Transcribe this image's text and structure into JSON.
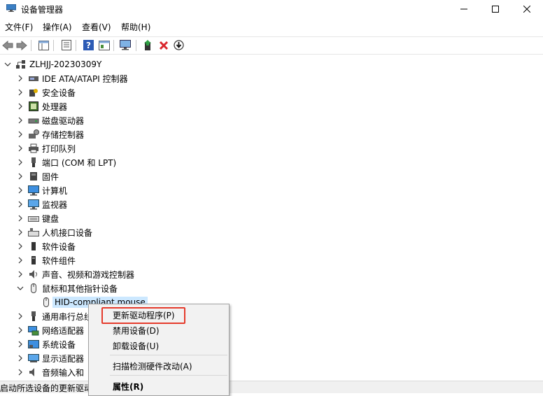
{
  "window": {
    "title": "设备管理器"
  },
  "menu": [
    "文件(F)",
    "操作(A)",
    "查看(V)",
    "帮助(H)"
  ],
  "toolbar": {
    "icons": [
      "back-arrow-icon",
      "forward-arrow-icon",
      "properties-icon",
      "driver-icon",
      "help-icon",
      "view-icon",
      "monitor-scan-icon",
      "update-driver-icon",
      "uninstall-x-icon",
      "download-icon"
    ]
  },
  "tree": {
    "root": "ZLHJJ-20230309Y",
    "items": [
      "IDE ATA/ATAPI 控制器",
      "安全设备",
      "处理器",
      "磁盘驱动器",
      "存储控制器",
      "打印队列",
      "端口 (COM 和 LPT)",
      "固件",
      "计算机",
      "监视器",
      "键盘",
      "人机接口设备",
      "软件设备",
      "软件组件",
      "声音、视频和游戏控制器",
      "鼠标和其他指针设备",
      "HID-compliant mouse",
      "通用串行总线",
      "网络适配器",
      "系统设备",
      "显示适配器",
      "音频输入和"
    ]
  },
  "context_menu": {
    "update_driver": "更新驱动程序(P)",
    "disable": "禁用设备(D)",
    "uninstall": "卸载设备(U)",
    "scan": "扫描检测硬件改动(A)",
    "properties": "属性(R)"
  },
  "status": "启动所选设备的更新驱动",
  "colors": {
    "selection": "#cce8ff",
    "highlight_border": "#e53b2c",
    "close_x": "#d9262c"
  }
}
